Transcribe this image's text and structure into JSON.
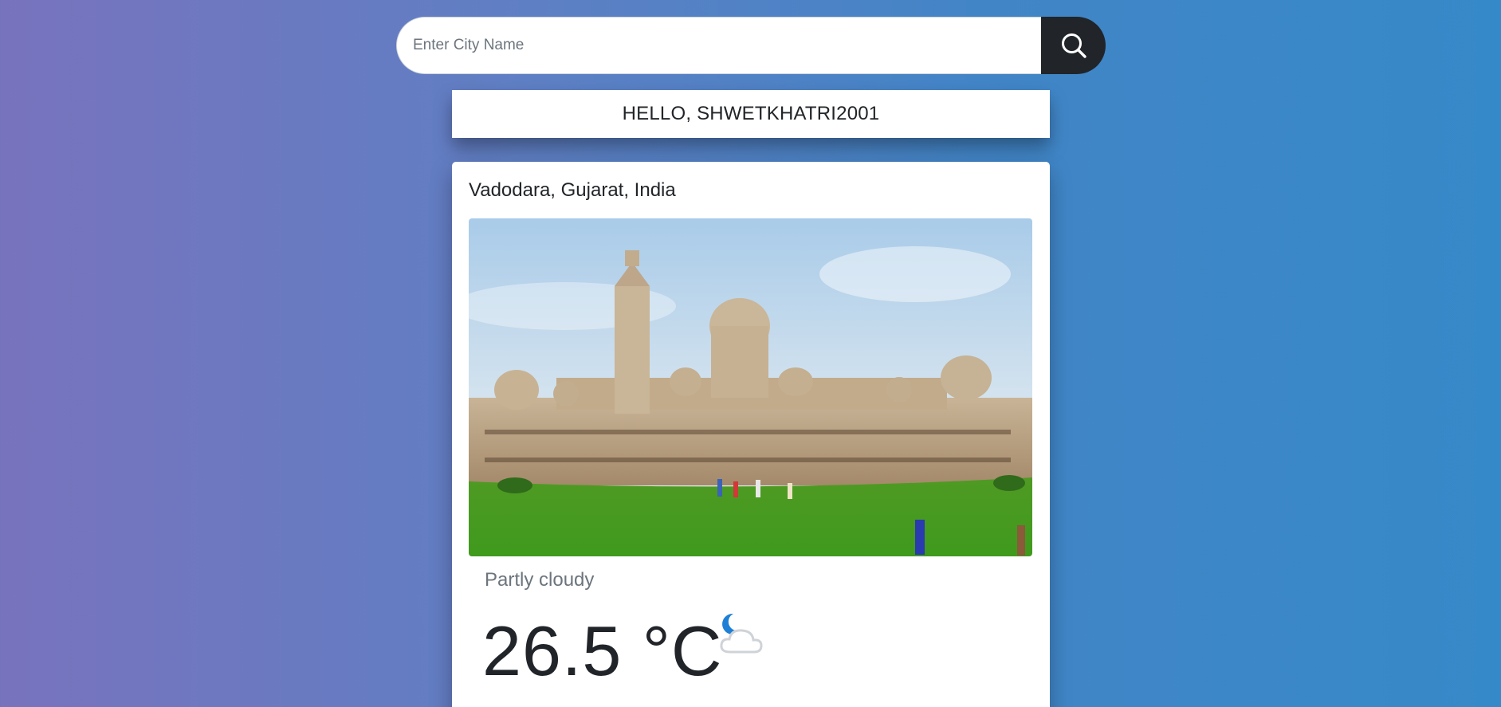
{
  "search": {
    "placeholder": "Enter City Name",
    "value": "",
    "button_icon": "search-icon"
  },
  "greeting": {
    "text": "HELLO, SHWETKHATRI2001"
  },
  "weather": {
    "location": "Vadodara, Gujarat, India",
    "photo": "city-landmark-photo",
    "condition": "Partly cloudy",
    "temperature": "26.5 °C",
    "icon": "partly-cloudy-night-icon"
  },
  "colors": {
    "gradient_start": "#7873bd",
    "gradient_end": "#3689c8",
    "search_button": "#212529",
    "card": "#ffffff",
    "icon_moon": "#1e7fd6",
    "icon_cloud": "#d0d4d8"
  }
}
